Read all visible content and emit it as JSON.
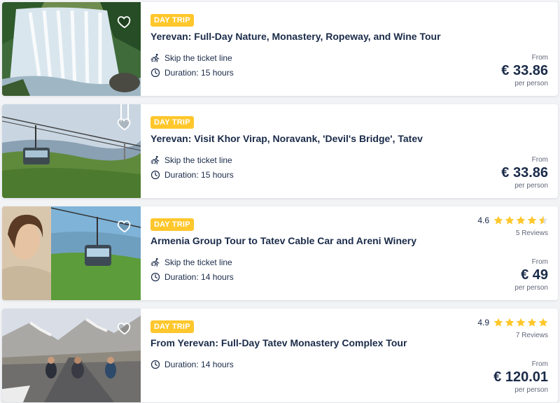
{
  "colors": {
    "badge": "#ffc72c",
    "text": "#1a2b49",
    "muted": "#63687a",
    "star": "#ffc72c"
  },
  "cards": [
    {
      "badge": "DAY TRIP",
      "title": "Yerevan: Full-Day Nature, Monastery, Ropeway, and Wine Tour",
      "features": [
        {
          "icon": "skip-line-icon",
          "text": "Skip the ticket line"
        },
        {
          "icon": "clock-icon",
          "text": "Duration: 15 hours"
        }
      ],
      "price_from": "From",
      "price": "€ 33.86",
      "price_per": "per person",
      "image": "waterfall"
    },
    {
      "badge": "DAY TRIP",
      "title": "Yerevan: Visit Khor Virap, Noravank, 'Devil's Bridge', Tatev",
      "features": [
        {
          "icon": "skip-line-icon",
          "text": "Skip the ticket line"
        },
        {
          "icon": "clock-icon",
          "text": "Duration: 15 hours"
        }
      ],
      "price_from": "From",
      "price": "€ 33.86",
      "price_per": "per person",
      "image": "cable-car"
    },
    {
      "badge": "DAY TRIP",
      "title": "Armenia Group Tour to Tatev Cable Car and Areni Winery",
      "rating": "4.6",
      "rating_value": 4.6,
      "reviews": "5 Reviews",
      "features": [
        {
          "icon": "skip-line-icon",
          "text": "Skip the ticket line"
        },
        {
          "icon": "clock-icon",
          "text": "Duration: 14 hours"
        }
      ],
      "price_from": "From",
      "price": "€ 49",
      "price_per": "per person",
      "image": "woman-cable-car"
    },
    {
      "badge": "DAY TRIP",
      "title": "From Yerevan: Full-Day Tatev Monastery Complex Tour",
      "rating": "4.9",
      "rating_value": 4.9,
      "reviews": "7 Reviews",
      "features": [
        {
          "icon": "clock-icon",
          "text": "Duration: 14 hours"
        }
      ],
      "price_from": "From",
      "price": "€ 120.01",
      "price_per": "per person",
      "image": "mountain-road"
    }
  ]
}
